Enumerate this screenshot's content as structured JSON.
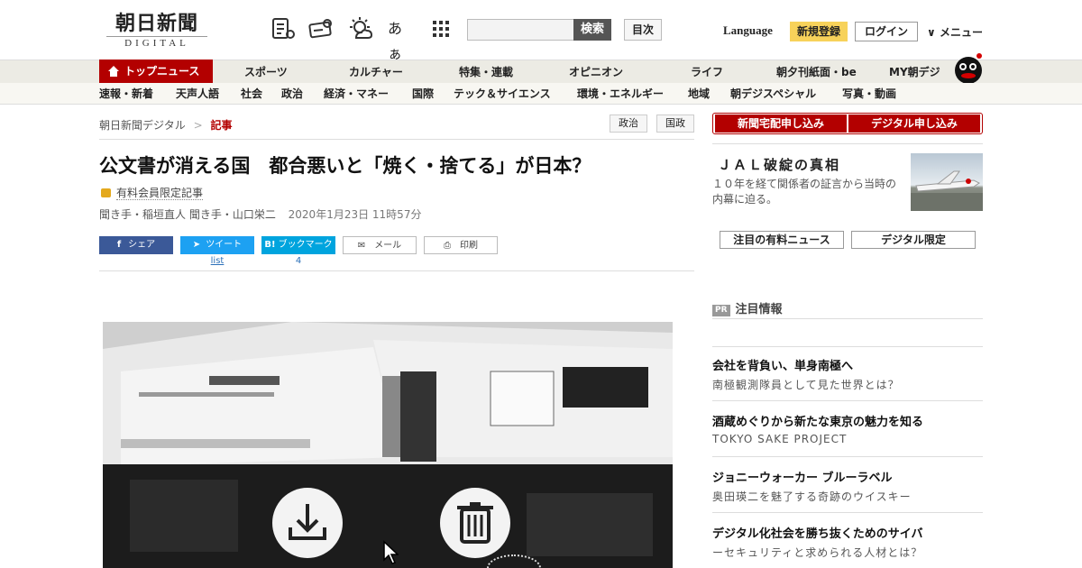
{
  "header": {
    "logo_main": "朝日新聞",
    "logo_sub": "DIGITAL",
    "search_button": "検索",
    "toc_button": "目次",
    "language": "Language",
    "register": "新規登録",
    "login": "ログイン",
    "menu": "メニュー",
    "icons": [
      "newspaper-icon",
      "digital-ticket-icon",
      "weather-icon",
      "font-size-icon",
      "grid-menu-icon"
    ],
    "font_icon_text": "あぁ"
  },
  "nav_primary": {
    "active": "トップニュース",
    "items": [
      "スポーツ",
      "カルチャー",
      "特集・連載",
      "オピニオン",
      "ライフ",
      "朝夕刊紙面・be",
      "MY朝デジ"
    ]
  },
  "nav_secondary": {
    "items": [
      "速報・新着",
      "天声人語",
      "社会",
      "政治",
      "経済・マネー",
      "国際",
      "テック＆サイエンス",
      "環境・エネルギー",
      "地域",
      "朝デジスペシャル",
      "写真・動画"
    ]
  },
  "article": {
    "breadcrumb_root": "朝日新聞デジタル",
    "breadcrumb_sep": ">",
    "breadcrumb_current": "記事",
    "tags": [
      "政治",
      "国政"
    ],
    "title": "公文書が消える国　都合悪いと「焼く・捨てる」が日本？",
    "premium_label": "有料会員限定記事",
    "byline": "聞き手・稲垣直人 聞き手・山口栄二",
    "date": "2020年1月23日 11時57分",
    "share": {
      "facebook": "シェア",
      "twitter": "ツイート",
      "twitter_sub": "list",
      "hatena": "ブックマーク",
      "hatena_sub": "4",
      "mail": "メール",
      "print": "印刷"
    }
  },
  "sidebar": {
    "subscribe_paper": "新聞宅配申し込み",
    "subscribe_digital": "デジタル申し込み",
    "feature_title": "ＪＡＬ破綻の真相",
    "feature_desc": "１０年を経て関係者の証言から当時の内幕に迫る。",
    "tabs": [
      "注目の有料ニュース",
      "デジタル限定"
    ],
    "pr_badge": "PR",
    "pr_heading": "注目情報",
    "pr_items": [
      {
        "title": "会社を背負い、単身南極へ",
        "sub": "南極観測隊員として見た世界とは？"
      },
      {
        "title": "酒蔵めぐりから新たな東京の魅力を知る",
        "sub": "TOKYO SAKE PROJECT"
      },
      {
        "title": "ジョニーウォーカー ブルーラベル",
        "sub": "奥田瑛二を魅了する奇跡のウイスキー"
      },
      {
        "title": "デジタル化社会を勝ち抜くためのサイバ",
        "sub": "ーセキュリティと求められる人材とは？"
      }
    ]
  },
  "colors": {
    "brand_red": "#b30000",
    "facebook": "#3b5998",
    "twitter": "#1da1f2",
    "hatena": "#00a4de",
    "register_yellow": "#f7d25a"
  }
}
